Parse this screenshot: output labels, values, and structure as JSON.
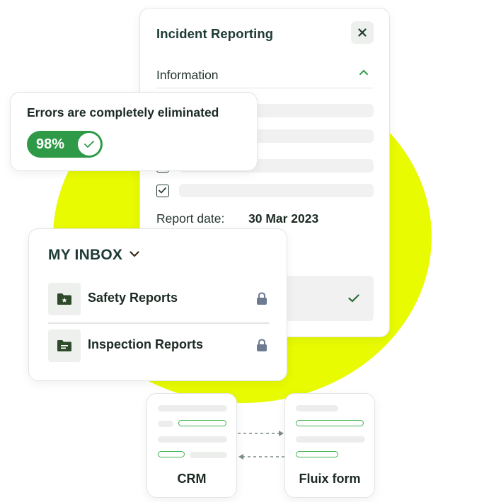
{
  "incident": {
    "title": "Incident Reporting",
    "close_icon": "close-icon",
    "section_label": "Information",
    "report_date_label": "Report date:",
    "report_date_value": "30 Mar 2023"
  },
  "errors": {
    "text": "Errors are completely eliminated",
    "percent": "98%"
  },
  "inbox": {
    "title": "MY INBOX",
    "items": [
      {
        "label": "Safety Reports",
        "icon": "folder-star-icon",
        "lock": "lock-icon"
      },
      {
        "label": "Inspection Reports",
        "icon": "folder-lines-icon",
        "lock": "lock-icon"
      }
    ]
  },
  "integrations": {
    "left_label": "CRM",
    "right_label": "Fluix form"
  },
  "colors": {
    "accent_yellow": "#e8fb00",
    "brand_green": "#2e9a47",
    "dark_green": "#2f4a2a",
    "navy_title": "#1e3a35"
  }
}
